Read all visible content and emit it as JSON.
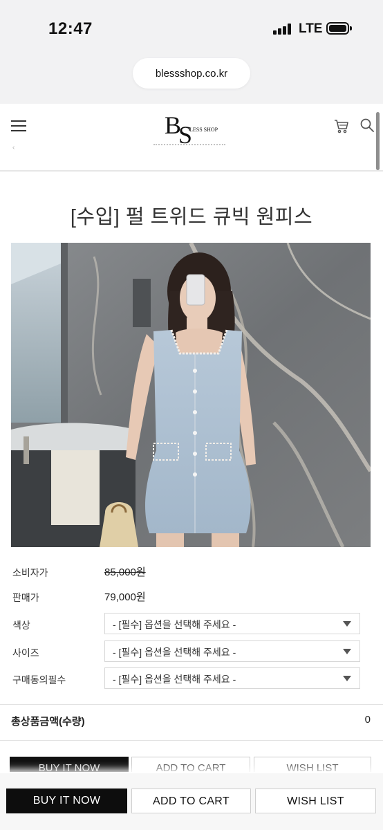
{
  "status_bar": {
    "time": "12:47",
    "network": "LTE"
  },
  "browser": {
    "url": "blessshop.co.kr"
  },
  "header": {
    "logo_b": "B",
    "logo_s": "S",
    "logo_text": "LESS SHOP"
  },
  "product": {
    "title": "[수입] 펄 트위드 큐빅 원피스",
    "retail_label": "소비자가",
    "retail_price": "85,000원",
    "sale_label": "판매가",
    "sale_price": "79,000원",
    "options": [
      {
        "label": "색상",
        "value": "- [필수] 옵션을 선택해 주세요 -"
      },
      {
        "label": "사이즈",
        "value": "- [필수] 옵션을 선택해 주세요 -"
      },
      {
        "label": "구매동의필수",
        "value": "- [필수] 옵션을 선택해 주세요 -"
      }
    ],
    "total_label": "총상품금액(수량)",
    "total_value": "0"
  },
  "actions": {
    "buy": "BUY IT NOW",
    "cart": "ADD TO CART",
    "wish": "WISH LIST"
  },
  "colors": {
    "primary_button": "#0d0d0d",
    "background": "#ffffff",
    "chrome": "#f2f2f3"
  }
}
